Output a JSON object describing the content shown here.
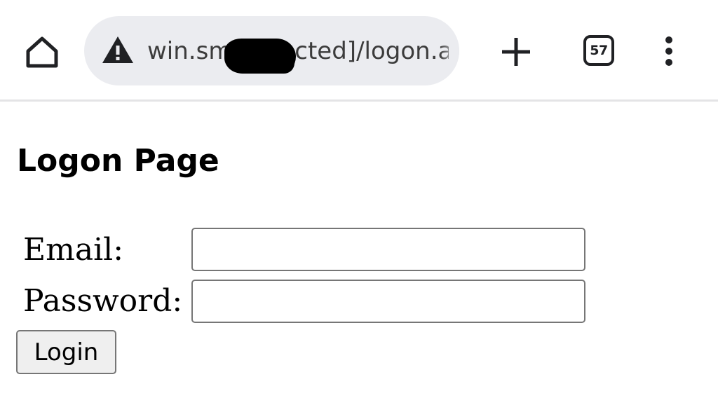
{
  "browser": {
    "url": "win.sm[redacted]/logon.aspx?",
    "tab_count": "57",
    "icons": {
      "home": "home-icon",
      "security_warning": "warning-triangle-icon",
      "new_tab": "plus-icon",
      "tabs": "tab-switcher-icon",
      "menu": "more-vertical-icon"
    }
  },
  "page": {
    "title": "Logon Page",
    "form": {
      "email_label": "Email:",
      "email_value": "",
      "password_label": "Password:",
      "password_value": "",
      "login_label": "Login"
    }
  }
}
